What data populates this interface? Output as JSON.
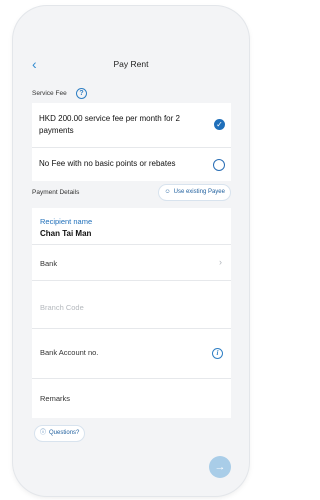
{
  "header": {
    "back_icon": "chevron-left-icon",
    "title": "Pay Rent"
  },
  "service_fee": {
    "label": "Service Fee",
    "options": [
      {
        "text": "HKD 200.00 service fee per month for 2 payments",
        "selected": true
      },
      {
        "text": "No Fee with no basic points or rebates",
        "selected": false
      }
    ]
  },
  "payment_details": {
    "label": "Payment Details",
    "use_existing_payee": "Use existing Payee",
    "recipient": {
      "label": "Recipient name",
      "value": "Chan Tai Man"
    },
    "bank": {
      "label": "Bank"
    },
    "branch_code": {
      "placeholder": "Branch Code"
    },
    "account": {
      "label": "Bank Account no."
    },
    "remarks": {
      "label": "Remarks"
    }
  },
  "questions_label": "Questions?",
  "colors": {
    "accent": "#1f6fba",
    "link": "#2f7fc4",
    "background": "#f3f4f6"
  }
}
